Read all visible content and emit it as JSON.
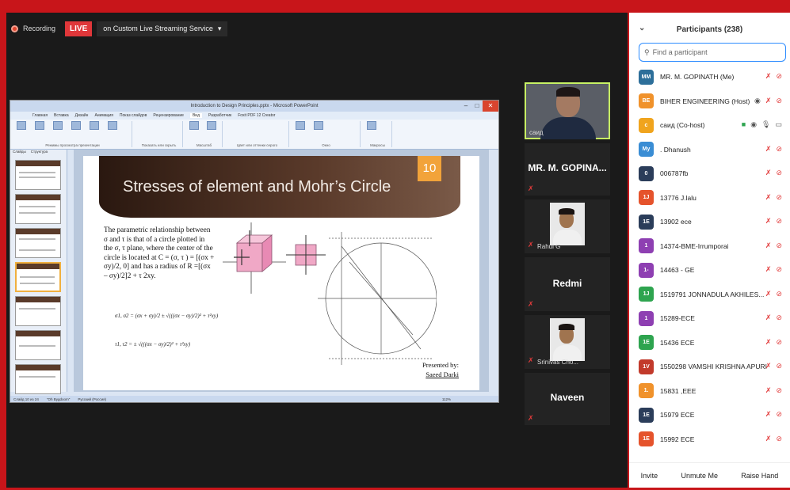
{
  "recording": {
    "label": "Recording"
  },
  "live": {
    "badge": "LIVE",
    "service": "on Custom Live Streaming Service"
  },
  "ppt": {
    "window_title": "Introduction to Design Principles.pptx - Microsoft PowerPoint",
    "ribbon_tabs": [
      "Главная",
      "Вставка",
      "Дизайн",
      "Анимация",
      "Показ слайдов",
      "Рецензирование",
      "Вид",
      "Разработчик",
      "Foxit PDF 12 Creator"
    ],
    "ribbon_groups": [
      "Режимы просмотра презентации",
      "Показать или скрыть",
      "Масштаб",
      "Цвет или оттенки серого",
      "Окно",
      "Макросы"
    ],
    "pane_tabs": [
      "Слайды",
      "Структура"
    ],
    "status_left": "Слайд 10 из 24",
    "status_theme": "\"Oh Bygdoom\"",
    "status_lang": "Русский (Россия)",
    "zoom": "112%"
  },
  "slide": {
    "title": "Stresses of element and Mohr’s Circle",
    "number": "10",
    "body": "The parametric relationship between σ and τ is that of a circle plotted in the σ, τ plane, where the center of the circle is located at C = (σ, τ ) = [(σx + σy)/2, 0] and has a radius of R =[(σx – σy)/2]2 + τ 2xy.",
    "eq1": "σ1, σ2 = (σx + σy)/2 ± √(((σx − σy)/2)² + τ²xy)",
    "eq2": "τ1, τ2 = ± √(((σx − σy)/2)² + τ²xy)",
    "presenter_line1": "Presented by:",
    "presenter_line2": "Saeed Darki"
  },
  "tiles": [
    {
      "name": "саид"
    },
    {
      "name": "MR. M. GOPINA..."
    },
    {
      "name": "Rahul G"
    },
    {
      "name": "Redmi"
    },
    {
      "name": "Srinivas Cho..."
    },
    {
      "name": "Naveen"
    }
  ],
  "participants": {
    "title": "Participants (238)",
    "search_placeholder": "Find a participant",
    "list": [
      {
        "initials": "MM",
        "name": "MR. M. GOPINATH (Me)",
        "color": "#2d6f9a"
      },
      {
        "initials": "BE",
        "name": "BIHER ENGINEERING (Host)",
        "color": "#f0922b"
      },
      {
        "initials": "с",
        "name": "саид (Co-host)",
        "color": "#f0a41d"
      },
      {
        "initials": "My",
        "name": ". Dhanush",
        "color": "#3a8dd4"
      },
      {
        "initials": "0",
        "name": "006787fb",
        "color": "#2b3d5a"
      },
      {
        "initials": "1J",
        "name": "13776 J.lalu",
        "color": "#e5532c"
      },
      {
        "initials": "1E",
        "name": "13902 ece",
        "color": "#2b3d5a"
      },
      {
        "initials": "1",
        "name": "14374-BME-Irrumporai",
        "color": "#8e3fb2"
      },
      {
        "initials": "1-",
        "name": "14463 - GE",
        "color": "#8e3fb2"
      },
      {
        "initials": "1J",
        "name": "1519791 JONNADULA AKHILES...",
        "color": "#2ea44f"
      },
      {
        "initials": "1",
        "name": "15289-ECE",
        "color": "#8e3fb2"
      },
      {
        "initials": "1E",
        "name": "15436 ECE",
        "color": "#2ea44f"
      },
      {
        "initials": "1V",
        "name": "1550298 VAMSHI KRISHNA APURI",
        "color": "#c23a2b"
      },
      {
        "initials": "1.",
        "name": "15831 ,EEE",
        "color": "#f0922b"
      },
      {
        "initials": "1E",
        "name": "15979 ECE",
        "color": "#2b3d5a"
      },
      {
        "initials": "1E",
        "name": "15992 ECE",
        "color": "#e5532c"
      }
    ],
    "footer": {
      "invite": "Invite",
      "unmute": "Unmute Me",
      "raise": "Raise Hand"
    }
  }
}
